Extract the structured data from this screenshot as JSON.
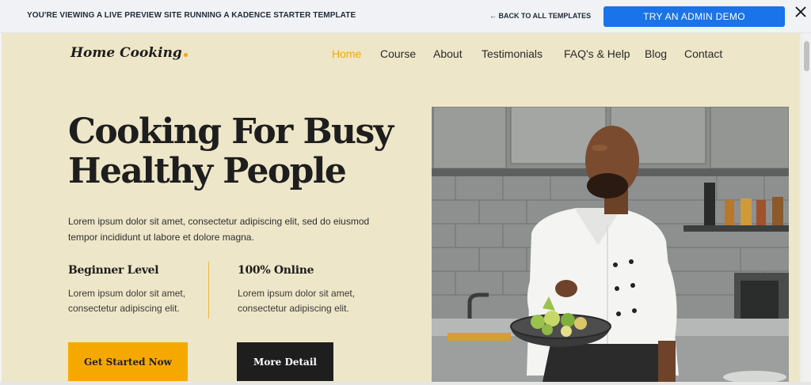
{
  "preview_bar": {
    "message": "YOU'RE VIEWING A LIVE PREVIEW SITE RUNNING A KADENCE STARTER TEMPLATE",
    "back_link": "← BACK TO ALL TEMPLATES",
    "admin_button": "TRY AN ADMIN DEMO",
    "close_icon": "close-icon"
  },
  "header": {
    "logo": "Home Cooking",
    "nav": [
      {
        "label": "Home",
        "active": true
      },
      {
        "label": "Course",
        "active": false
      },
      {
        "label": "About",
        "active": false
      },
      {
        "label": "Testimonials",
        "active": false
      },
      {
        "label": "FAQ's & Help",
        "active": false
      },
      {
        "label": "Blog",
        "active": false
      },
      {
        "label": "Contact",
        "active": false
      }
    ]
  },
  "hero": {
    "title_line1": "Cooking For Busy",
    "title_line2": "Healthy People",
    "text": "Lorem ipsum dolor sit amet, consectetur adipiscing elit, sed do eiusmod tempor incididunt ut labore et dolore magna.",
    "features": [
      {
        "title": "Beginner Level",
        "text": "Lorem ipsum dolor sit amet, consectetur adipiscing elit."
      },
      {
        "title": "100% Online",
        "text": "Lorem ipsum dolor sit amet, consectetur adipiscing elit."
      }
    ],
    "primary_button": "Get Started Now",
    "secondary_button": "More Detail",
    "image": "chef-cooking-photo"
  },
  "colors": {
    "accent": "#f5a900",
    "background": "#ede6c8",
    "dark": "#1e1e1e",
    "admin_blue": "#1a73e8"
  }
}
